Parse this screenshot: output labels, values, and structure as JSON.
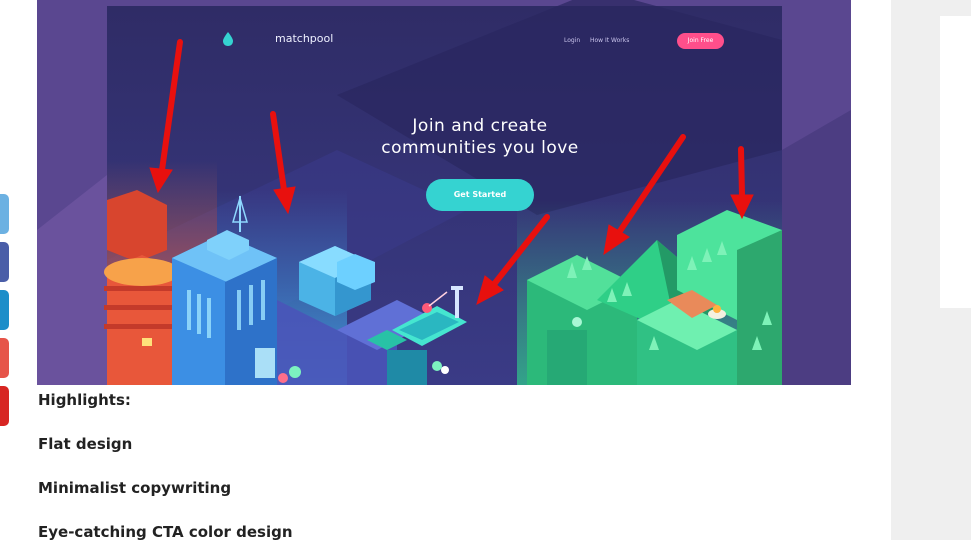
{
  "screenshot": {
    "brand": "matchpool",
    "nav_login": "Login",
    "nav_how": "How It Works",
    "join_label": "Join Free",
    "hero_line1": "Join and create",
    "hero_line2": "communities you love",
    "cta_label": "Get Started"
  },
  "article": {
    "heading": "Highlights:",
    "items": [
      "Flat design",
      "Minimalist copywriting",
      "Eye-catching CTA color design"
    ]
  },
  "share_buttons": [
    {
      "name": "twitter",
      "color": "#6cb1e2"
    },
    {
      "name": "facebook",
      "color": "#4a5ea8"
    },
    {
      "name": "linkedin",
      "color": "#1d8ec9"
    },
    {
      "name": "google-plus",
      "color": "#e65449"
    },
    {
      "name": "pinterest",
      "color": "#d72522"
    }
  ],
  "colors": {
    "hero_bg": "#34306e",
    "cta": "#35d3d1",
    "join": "#ff4f8b",
    "arrow": "#e8100e"
  }
}
